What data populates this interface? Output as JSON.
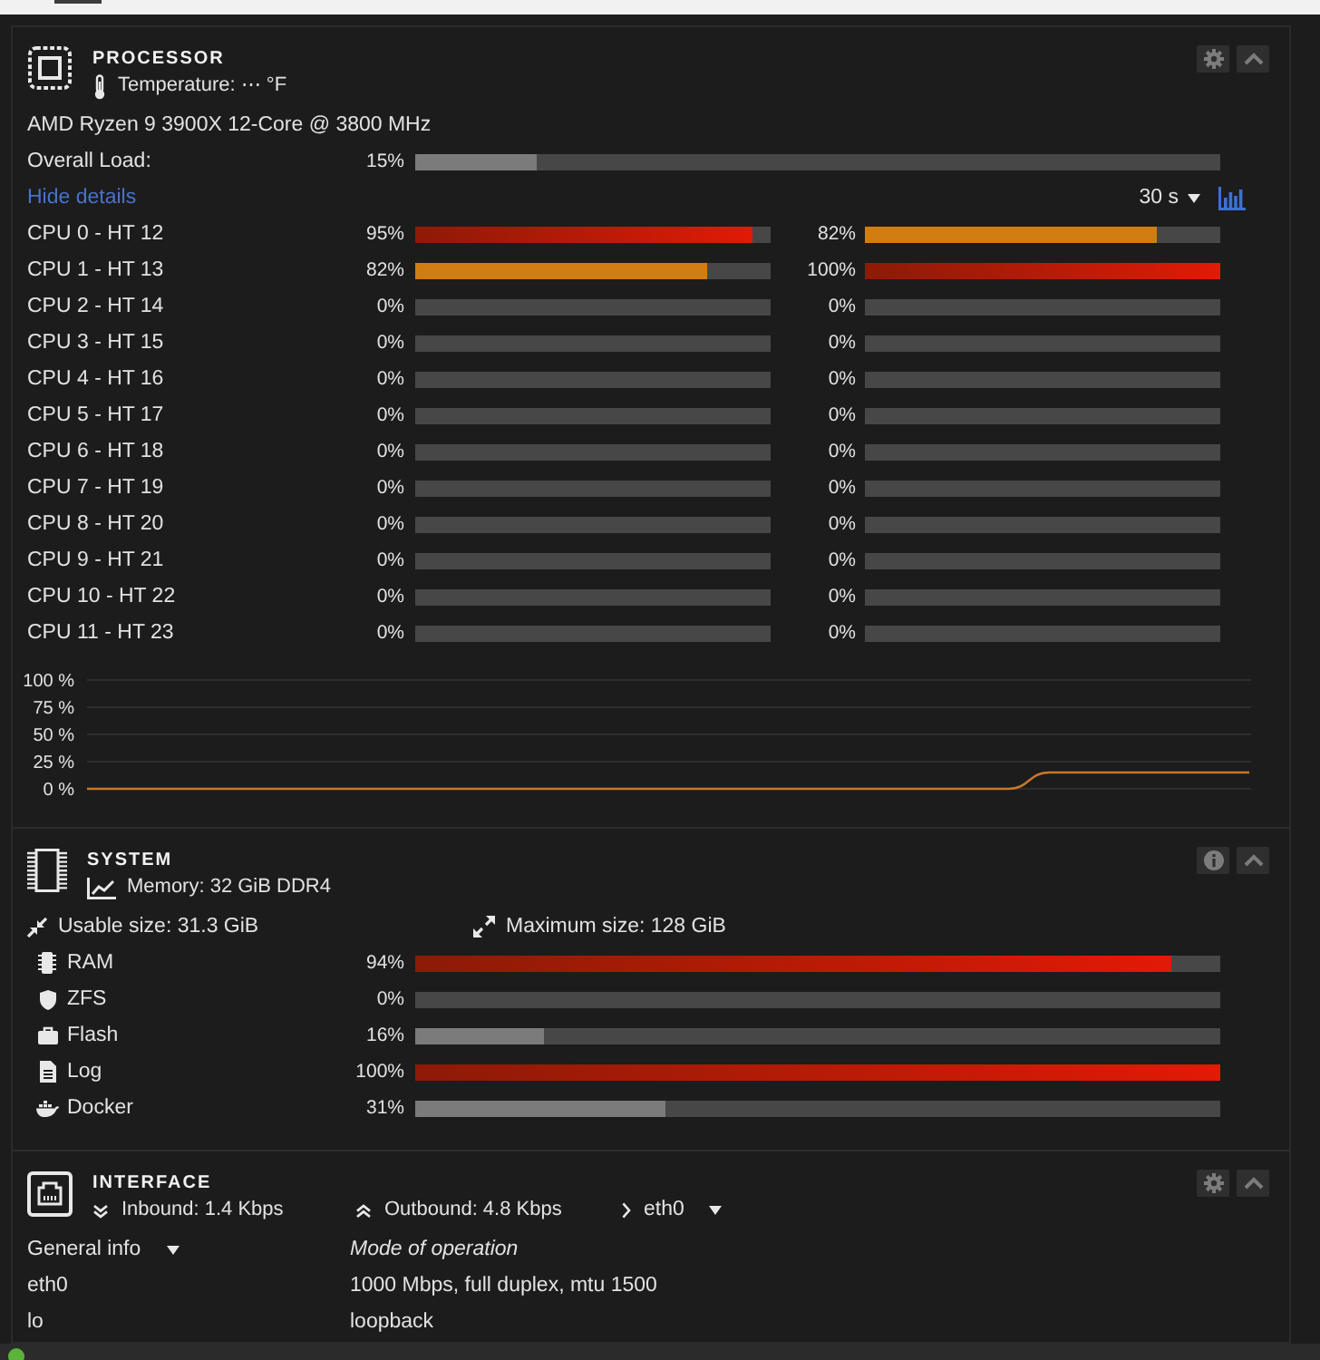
{
  "processor": {
    "title": "PROCESSOR",
    "temperature": "Temperature: ⋯ °F",
    "model": "AMD Ryzen 9 3900X 12-Core @ 3800 MHz",
    "overall": {
      "label": "Overall Load:",
      "reading": "15%",
      "level": 0.15
    },
    "details_link": "Hide details",
    "interval": "30 s",
    "cores": [
      {
        "label": "CPU 0 - HT 12",
        "threads": [
          {
            "reading": "95%",
            "level": 0.95
          },
          {
            "reading": "82%",
            "level": 0.82
          }
        ]
      },
      {
        "label": "CPU 1 - HT 13",
        "threads": [
          {
            "reading": "82%",
            "level": 0.82
          },
          {
            "reading": "100%",
            "level": 1
          }
        ]
      },
      {
        "label": "CPU 2 - HT 14",
        "threads": [
          {
            "reading": "0%",
            "level": 0
          },
          {
            "reading": "0%",
            "level": 0
          }
        ]
      },
      {
        "label": "CPU 3 - HT 15",
        "threads": [
          {
            "reading": "0%",
            "level": 0
          },
          {
            "reading": "0%",
            "level": 0
          }
        ]
      },
      {
        "label": "CPU 4 - HT 16",
        "threads": [
          {
            "reading": "0%",
            "level": 0
          },
          {
            "reading": "0%",
            "level": 0
          }
        ]
      },
      {
        "label": "CPU 5 - HT 17",
        "threads": [
          {
            "reading": "0%",
            "level": 0
          },
          {
            "reading": "0%",
            "level": 0
          }
        ]
      },
      {
        "label": "CPU 6 - HT 18",
        "threads": [
          {
            "reading": "0%",
            "level": 0
          },
          {
            "reading": "0%",
            "level": 0
          }
        ]
      },
      {
        "label": "CPU 7 - HT 19",
        "threads": [
          {
            "reading": "0%",
            "level": 0
          },
          {
            "reading": "0%",
            "level": 0
          }
        ]
      },
      {
        "label": "CPU 8 - HT 20",
        "threads": [
          {
            "reading": "0%",
            "level": 0
          },
          {
            "reading": "0%",
            "level": 0
          }
        ]
      },
      {
        "label": "CPU 9 - HT 21",
        "threads": [
          {
            "reading": "0%",
            "level": 0
          },
          {
            "reading": "0%",
            "level": 0
          }
        ]
      },
      {
        "label": "CPU 10 - HT 22",
        "threads": [
          {
            "reading": "0%",
            "level": 0
          },
          {
            "reading": "0%",
            "level": 0
          }
        ]
      },
      {
        "label": "CPU 11 - HT 23",
        "threads": [
          {
            "reading": "0%",
            "level": 0
          },
          {
            "reading": "0%",
            "level": 0
          }
        ]
      }
    ],
    "chart_data": {
      "type": "line",
      "grid": true,
      "ylim": [
        0,
        100
      ],
      "yticks": [
        {
          "value": 100,
          "label": "100 %"
        },
        {
          "value": 75,
          "label": "75 %"
        },
        {
          "value": 50,
          "label": "50 %"
        },
        {
          "value": 25,
          "label": "25 %"
        },
        {
          "value": 0,
          "label": "0 %"
        }
      ],
      "values": [
        0,
        0,
        0,
        0,
        0,
        0,
        0,
        0,
        0,
        0,
        0,
        0,
        0,
        0,
        0,
        0,
        0,
        0,
        0,
        0,
        0,
        0,
        0,
        0,
        15,
        15,
        15,
        15,
        15,
        15
      ]
    }
  },
  "system": {
    "title": "SYSTEM",
    "memory": "Memory: 32 GiB DDR4",
    "usable": "Usable size: 31.3 GiB",
    "maximum": "Maximum size: 128 GiB",
    "rows": [
      {
        "kind": "ram",
        "label": "RAM",
        "reading": "94%",
        "level": 0.94
      },
      {
        "kind": "zfs",
        "label": "ZFS",
        "reading": "0%",
        "level": 0
      },
      {
        "kind": "flash",
        "label": "Flash",
        "reading": "16%",
        "level": 0.16
      },
      {
        "kind": "log",
        "label": "Log",
        "reading": "100%",
        "level": 1
      },
      {
        "kind": "docker",
        "label": "Docker",
        "reading": "31%",
        "level": 0.31
      }
    ]
  },
  "interface": {
    "title": "INTERFACE",
    "inbound": "Inbound: 1.4 Kbps",
    "outbound": "Outbound: 4.8 Kbps",
    "port": "eth0",
    "info_select": "General info",
    "column_header": "Mode of operation",
    "rows": [
      {
        "name": "eth0",
        "mode": "1000 Mbps, full duplex, mtu 1500"
      },
      {
        "name": "lo",
        "mode": "loopback"
      }
    ]
  }
}
